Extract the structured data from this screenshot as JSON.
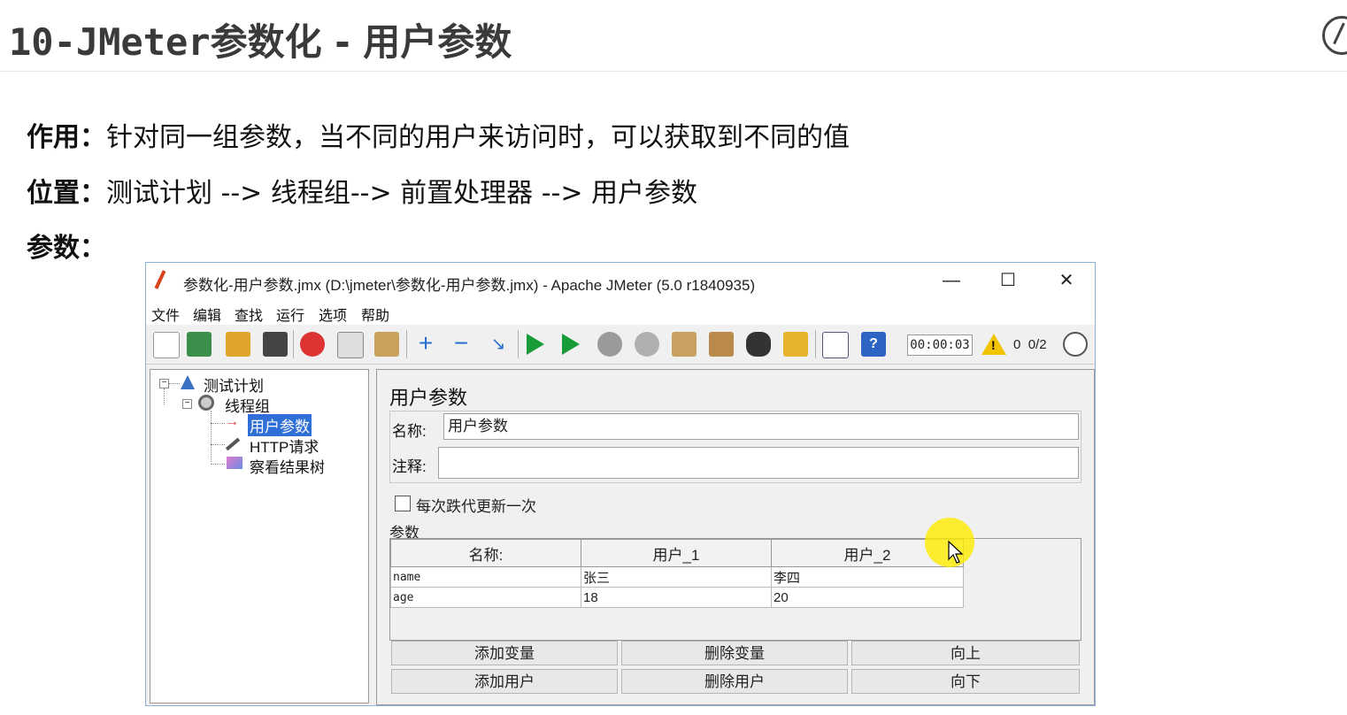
{
  "slide": {
    "title_prefix": "10-JMeter",
    "title_rest": "参数化 - 用户参数",
    "line1_label": "作用：",
    "line1_text": "针对同一组参数，当不同的用户来访问时，可以获取到不同的值",
    "line2_label": "位置：",
    "line2_text": "测试计划 --> 线程组--> 前置处理器 --> 用户参数",
    "line3_label": "参数："
  },
  "window": {
    "title": "参数化-用户参数.jmx (D:\\jmeter\\参数化-用户参数.jmx) - Apache JMeter (5.0 r1840935)",
    "min": "—",
    "max": "☐",
    "close": "✕",
    "menu": [
      "文件",
      "编辑",
      "查找",
      "运行",
      "选项",
      "帮助"
    ],
    "timer": "00:00:03",
    "warning_count": "0",
    "threads": "0/2"
  },
  "tree": {
    "root": "测试计划",
    "thread_group": "线程组",
    "user_params": "用户参数",
    "http_request": "HTTP请求",
    "result_tree": "察看结果树"
  },
  "panel": {
    "title": "用户参数",
    "name_label": "名称:",
    "name_value": "用户参数",
    "comment_label": "注释:",
    "comment_value": "",
    "checkbox_label": "每次跌代更新一次",
    "params_label": "参数",
    "columns": [
      "名称:",
      "用户_1",
      "用户_2"
    ],
    "rows": [
      [
        "name",
        "张三",
        "李四"
      ],
      [
        "age",
        "18",
        "20"
      ]
    ],
    "buttons": {
      "add_variable": "添加变量",
      "delete_variable": "删除变量",
      "move_up": "向上",
      "add_user": "添加用户",
      "delete_user": "删除用户",
      "move_down": "向下"
    }
  },
  "colors": {
    "selection": "#2f6fd6",
    "cursor_highlight": "#ffeb00",
    "window_border": "#8fb1d8"
  }
}
